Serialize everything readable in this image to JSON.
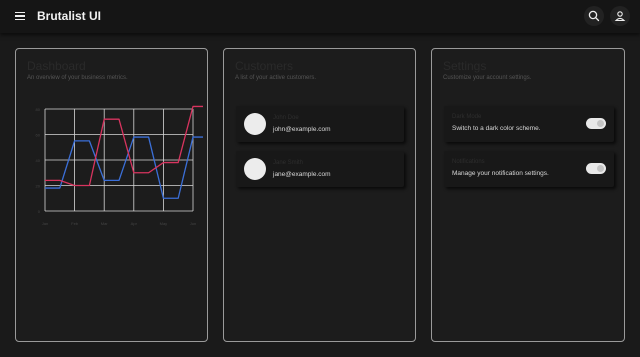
{
  "app": {
    "title": "Brutalist UI"
  },
  "header": {
    "menu_icon": "hamburger-menu-icon",
    "search_icon": "search-icon",
    "user_icon": "user-icon"
  },
  "cards": {
    "dashboard": {
      "title": "Dashboard",
      "description": "An overview of your business metrics."
    },
    "customers": {
      "title": "Customers",
      "description": "A list of your active customers.",
      "items": [
        {
          "name": "John Doe",
          "email": "john@example.com"
        },
        {
          "name": "Jane Smith",
          "email": "jane@example.com"
        }
      ]
    },
    "settings": {
      "title": "Settings",
      "description": "Customize your account settings.",
      "items": [
        {
          "label": "Dark Mode",
          "description": "Switch to a dark color scheme.",
          "enabled": true
        },
        {
          "label": "Notifications",
          "description": "Manage your notification settings.",
          "enabled": true
        }
      ]
    }
  },
  "chart_data": {
    "type": "line",
    "categories": [
      "Jan",
      "Feb",
      "Mar",
      "Apr",
      "May",
      "Jun"
    ],
    "y_ticks": [
      0,
      20,
      40,
      60,
      80
    ],
    "ylim": [
      0,
      80
    ],
    "grid": true,
    "series": [
      {
        "color": "#3b6fd8",
        "x": [
          0,
          0.5,
          1,
          1.5,
          2,
          2.5,
          3,
          3.5,
          4,
          4.5,
          5,
          5.5
        ],
        "values": [
          18,
          18,
          55,
          55,
          24,
          24,
          58,
          58,
          10,
          10,
          58,
          58
        ]
      },
      {
        "color": "#d8345f",
        "x": [
          0,
          0.5,
          1,
          1.5,
          2,
          2.5,
          3,
          3.5,
          4,
          4.5,
          5,
          5.5
        ],
        "values": [
          24,
          24,
          20,
          20,
          72,
          72,
          30,
          30,
          38,
          38,
          82,
          82
        ]
      }
    ]
  },
  "colors": {
    "background": "#1a1a1a",
    "card_border": "#9a9a9a",
    "series_blue": "#3b6fd8",
    "series_red": "#d8345f"
  }
}
